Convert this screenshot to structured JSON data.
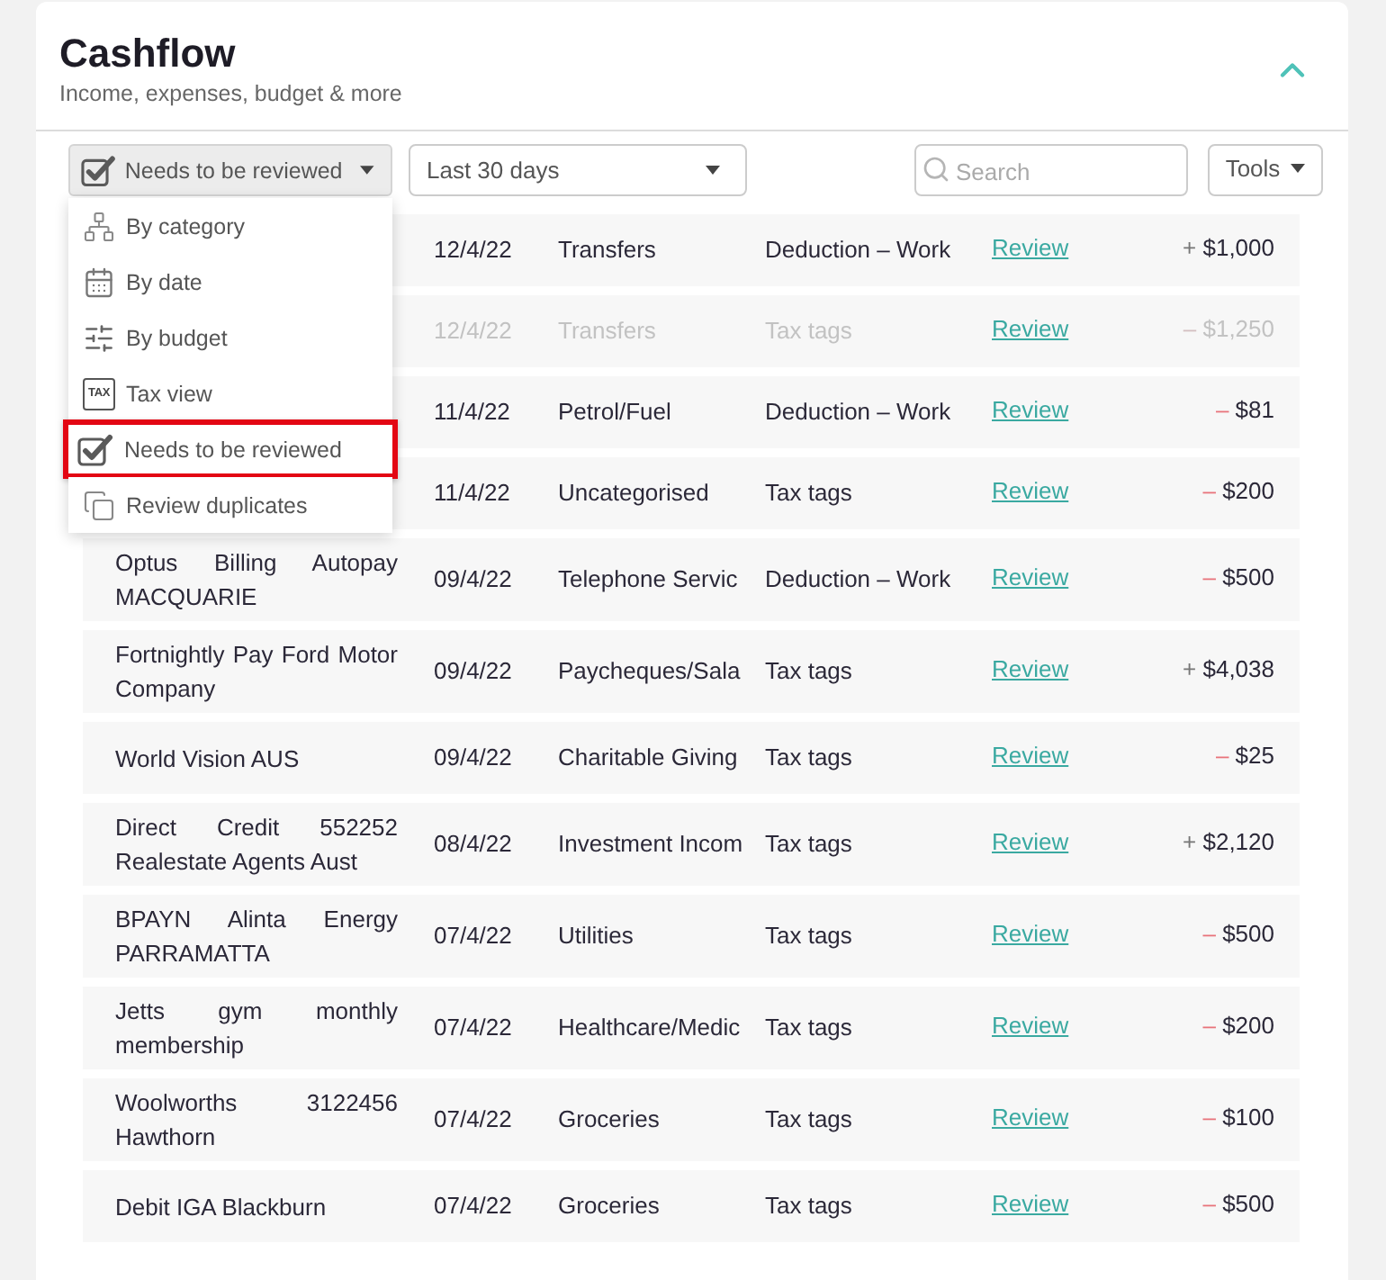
{
  "header": {
    "title": "Cashflow",
    "subtitle": "Income, expenses, budget & more",
    "expanded": true
  },
  "toolbar": {
    "filter": {
      "label": "Needs to be reviewed",
      "open": true
    },
    "period": {
      "label": "Last 30 days"
    },
    "search": {
      "placeholder": "Search"
    },
    "tools": {
      "label": "Tools"
    }
  },
  "filter_menu": {
    "items": [
      {
        "kind": "category",
        "label": "By category",
        "selected": false
      },
      {
        "kind": "date",
        "label": "By date",
        "selected": false
      },
      {
        "kind": "budget",
        "label": "By budget",
        "selected": false
      },
      {
        "kind": "tax",
        "badge": "TAX",
        "label": "Tax view",
        "selected": false
      },
      {
        "kind": "review",
        "label": "Needs to be reviewed",
        "selected": true
      },
      {
        "kind": "duplicates",
        "label": "Review duplicates",
        "selected": false
      }
    ]
  },
  "rows": [
    {
      "date": "12/4/22",
      "category": "Transfers",
      "tag": "Deduction – Work",
      "action": "Review",
      "sign": "+",
      "amount": "$1,000",
      "kind": "income",
      "dimmed": false
    },
    {
      "date": "12/4/22",
      "category": "Transfers",
      "tag": "Tax tags",
      "action": "Review",
      "sign": "–",
      "amount": "$1,250",
      "kind": "expense",
      "dimmed": true
    },
    {
      "date": "11/4/22",
      "category": "Petrol/Fuel",
      "tag": "Deduction – Work",
      "action": "Review",
      "sign": "–",
      "amount": "$81",
      "kind": "expense",
      "dimmed": false
    },
    {
      "date": "11/4/22",
      "category": "Uncategorised",
      "tag": "Tax tags",
      "action": "Review",
      "sign": "–",
      "amount": "$200",
      "kind": "expense",
      "dimmed": false
    },
    {
      "description": "Optus Billing Autopay MACQUARIE",
      "date": "09/4/22",
      "category": "Telephone Servic",
      "tag": "Deduction – Work",
      "action": "Review",
      "sign": "–",
      "amount": "$500",
      "kind": "expense",
      "dimmed": false
    },
    {
      "description": "Fortnightly Pay Ford Motor Company",
      "date": "09/4/22",
      "category": "Paycheques/Sala",
      "tag": "Tax tags",
      "action": "Review",
      "sign": "+",
      "amount": "$4,038",
      "kind": "income",
      "dimmed": false
    },
    {
      "description": "World Vision AUS",
      "date": "09/4/22",
      "category": "Charitable Giving",
      "tag": "Tax tags",
      "action": "Review",
      "sign": "–",
      "amount": "$25",
      "kind": "expense",
      "dimmed": false
    },
    {
      "description": "Direct Credit 552252 Realestate Agents Aust",
      "date": "08/4/22",
      "category": "Investment Incom",
      "tag": "Tax tags",
      "action": "Review",
      "sign": "+",
      "amount": "$2,120",
      "kind": "income",
      "dimmed": false
    },
    {
      "description": "BPAYN Alinta Energy PARRAMATTA",
      "date": "07/4/22",
      "category": "Utilities",
      "tag": "Tax tags",
      "action": "Review",
      "sign": "–",
      "amount": "$500",
      "kind": "expense",
      "dimmed": false
    },
    {
      "description": "Jetts gym monthly membership",
      "date": "07/4/22",
      "category": "Healthcare/Medic",
      "tag": "Tax tags",
      "action": "Review",
      "sign": "–",
      "amount": "$200",
      "kind": "expense",
      "dimmed": false
    },
    {
      "description": "Woolworths 3122456 Hawthorn",
      "date": "07/4/22",
      "category": "Groceries",
      "tag": "Tax tags",
      "action": "Review",
      "sign": "–",
      "amount": "$100",
      "kind": "expense",
      "dimmed": false
    },
    {
      "description": "Debit IGA Blackburn",
      "date": "07/4/22",
      "category": "Groceries",
      "tag": "Tax tags",
      "action": "Review",
      "sign": "–",
      "amount": "$500",
      "kind": "expense",
      "dimmed": false
    }
  ]
}
